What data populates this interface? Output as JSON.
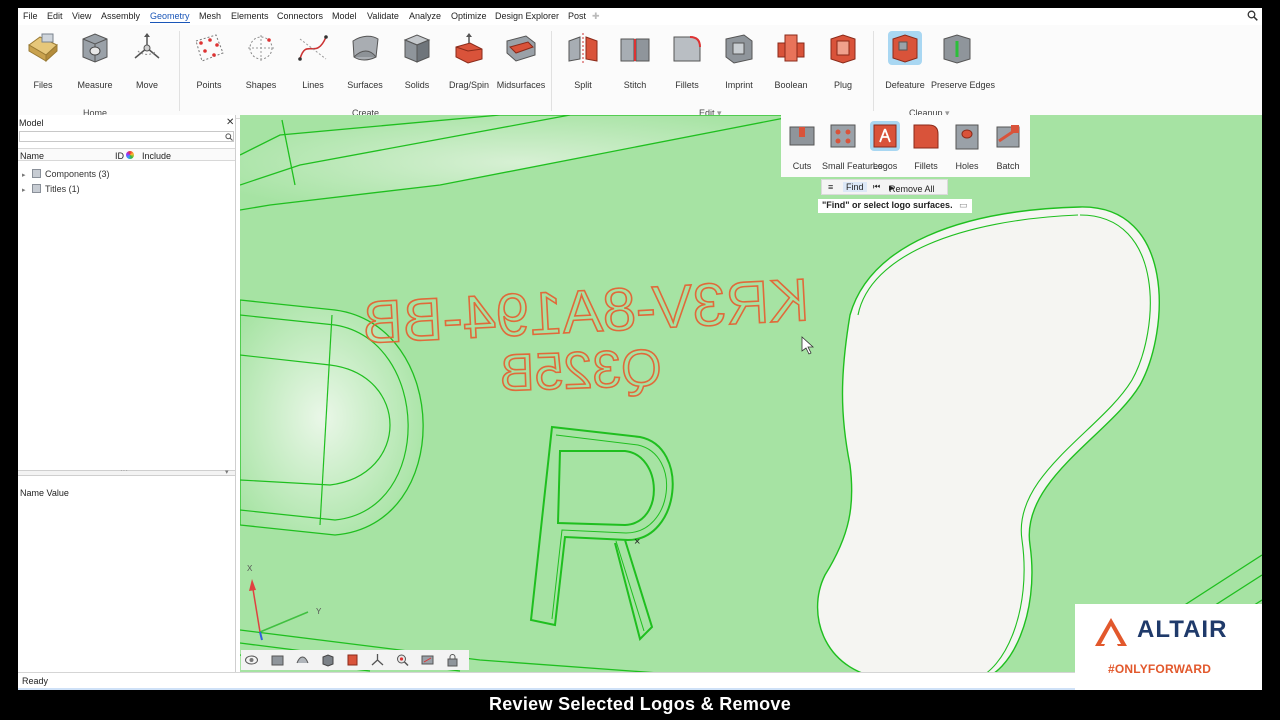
{
  "menu": [
    "File",
    "Edit",
    "View",
    "Assembly",
    "Geometry",
    "Mesh",
    "Elements",
    "Connectors",
    "Model",
    "Validate",
    "Analyze",
    "Optimize",
    "Design Explorer",
    "Post"
  ],
  "menu_active": "Geometry",
  "ribbon": {
    "tools": [
      "Files",
      "Measure",
      "Move",
      "Points",
      "Shapes",
      "Lines",
      "Surfaces",
      "Solids",
      "Drag/Spin",
      "Midsurfaces",
      "Split",
      "Stitch",
      "Fillets",
      "Imprint",
      "Boolean",
      "Plug",
      "Defeature",
      "Preserve Edges"
    ],
    "groups": [
      "Home",
      "Create",
      "Edit",
      "Cleanup"
    ]
  },
  "model_panel": {
    "title": "Model",
    "columns": [
      "Name",
      "ID",
      "Include"
    ],
    "rows": [
      "Components (3)",
      "Titles (1)"
    ],
    "property_header": "Name Value"
  },
  "defeature": {
    "tools": [
      "Cuts",
      "Small Features",
      "Logos",
      "Fillets",
      "Holes",
      "Batch"
    ],
    "active_tool": "Logos",
    "find_label": "Find",
    "remove_all_label": "Remove All",
    "hint": "\"Find\" or select logo surfaces."
  },
  "viewport": {
    "part_text_line1": "KR3V-8A194-BB",
    "part_text_line2": "Q325B",
    "part_letter": "R",
    "axis_x": "X",
    "axis_y": "Y"
  },
  "status": "Ready",
  "brand": {
    "name": "ALTAIR",
    "tagline": "#ONLYFORWARD"
  },
  "caption": "Review Selected Logos & Remove",
  "colors": {
    "viewport_fill": "#a6e3a3",
    "edge_green": "#1fbf1f",
    "logo_orange": "#e06a3a",
    "brand_orange": "#e2582c",
    "brand_blue": "#1f3a6a"
  }
}
